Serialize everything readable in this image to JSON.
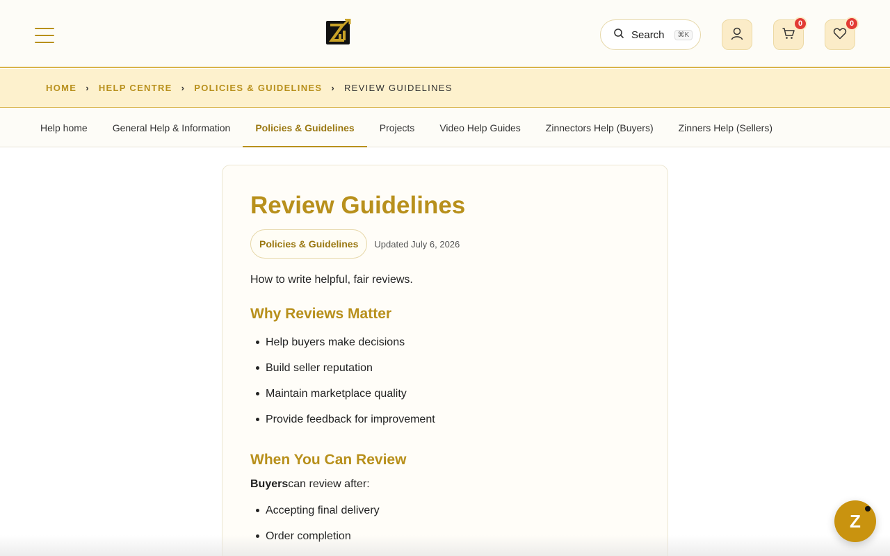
{
  "header": {
    "search_label": "Search",
    "search_shortcut": "⌘K",
    "cart_count": "0",
    "wishlist_count": "0",
    "brand_color": "#b8901c",
    "badge_color": "#e23b35"
  },
  "breadcrumb": [
    {
      "label": "HOME"
    },
    {
      "label": "HELP CENTRE"
    },
    {
      "label": "POLICIES & GUIDELINES"
    },
    {
      "label": "REVIEW GUIDELINES"
    }
  ],
  "tabs": [
    {
      "label": "Help home"
    },
    {
      "label": "General Help & Information"
    },
    {
      "label": "Policies & Guidelines"
    },
    {
      "label": "Projects"
    },
    {
      "label": "Video Help Guides"
    },
    {
      "label": "Zinnectors Help (Buyers)"
    },
    {
      "label": "Zinners Help (Sellers)"
    }
  ],
  "article": {
    "title": "Review Guidelines",
    "category": "Policies & Guidelines",
    "updated": "Updated July 6, 2026",
    "intro": "How to write helpful, fair reviews.",
    "section1": {
      "heading": "Why Reviews Matter",
      "items": [
        "Help buyers make decisions",
        "Build seller reputation",
        "Maintain marketplace quality",
        "Provide feedback for improvement"
      ]
    },
    "section2": {
      "heading": "When You Can Review",
      "para_bold": "Buyers",
      "para_rest": "can review after:",
      "items": [
        "Accepting final delivery",
        "Order completion"
      ]
    }
  },
  "chat": {
    "label": "Z"
  }
}
